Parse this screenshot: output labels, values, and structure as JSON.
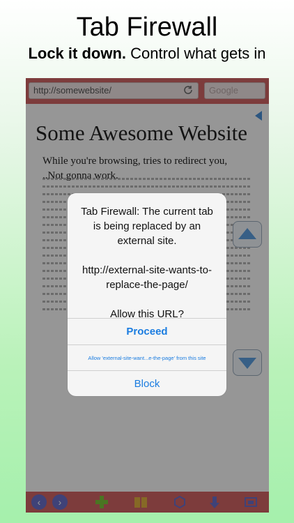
{
  "hero": {
    "title": "Tab Firewall",
    "subtitle_bold": "Lock it down.",
    "subtitle_rest": " Control what gets in"
  },
  "browser": {
    "url": "http://somewebsite/",
    "search_placeholder": "Google",
    "site_title": "Some Awesome Website",
    "site_line1": "While you're browsing, tries to redirect you,",
    "site_line2": "..Not gonna work."
  },
  "dialog": {
    "message_line1": "Tab Firewall: The current tab is being replaced by an external site.",
    "message_url": "http://external-site-wants-to-replace-the-page/",
    "message_question": "Allow this URL?",
    "proceed_label": "Proceed",
    "allow_site_label": "Allow 'external-site-want...e-the-page' from this site",
    "block_label": "Block"
  },
  "toolbar_icons": [
    "back-icon",
    "forward-icon",
    "add-tab-icon",
    "bookmarks-icon",
    "settings-icon",
    "download-icon",
    "tabs-icon"
  ]
}
